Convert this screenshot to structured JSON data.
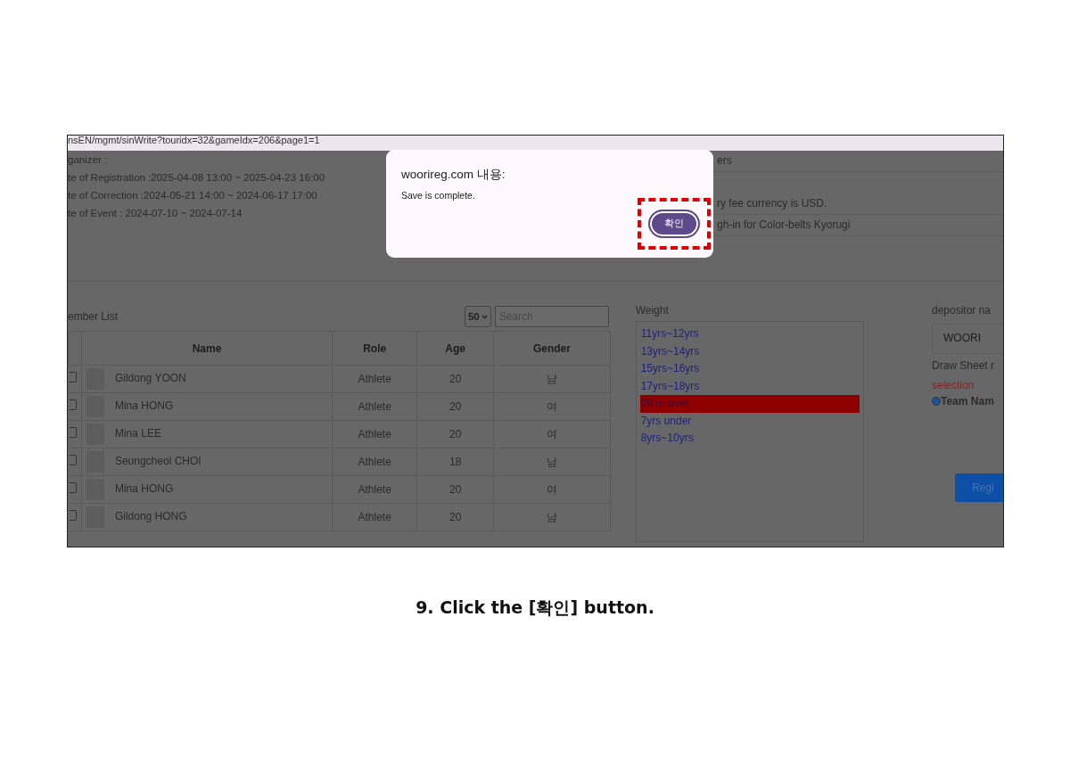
{
  "url_bar": {
    "text": "nsEN/mgmt/sinWrite?touridx=32&gameIdx=206&page1=1"
  },
  "event_info": [
    "ganizer :",
    "te of Registration :2025-04-08 13:00 ~ 2025-04-23 16:00",
    "te of Correction :2024-05-21 14:00 ~ 2024-06-17 17:00",
    "te of Event : 2024-07-10 ~ 2024-07-14"
  ],
  "notices": [
    "ers",
    "ry fee currency is USD.",
    "gh-in for Color-belts Kyorugi"
  ],
  "member_list": {
    "title": "ember List",
    "page_size": "50",
    "search_placeholder": "Search",
    "columns": [
      "Name",
      "Role",
      "Age",
      "Gender"
    ],
    "rows": [
      {
        "checked": false,
        "name": "Gildong YOON",
        "role": "Athlete",
        "age": "20",
        "gender": "남"
      },
      {
        "checked": false,
        "name": "Mina HONG",
        "role": "Athlete",
        "age": "20",
        "gender": "여"
      },
      {
        "checked": false,
        "name": "Mina LEE",
        "role": "Athlete",
        "age": "20",
        "gender": "여"
      },
      {
        "checked": false,
        "name": "Seungcheol CHOI",
        "role": "Athlete",
        "age": "18",
        "gender": "남"
      },
      {
        "checked": false,
        "name": "Mina HONG",
        "role": "Athlete",
        "age": "20",
        "gender": "여"
      },
      {
        "checked": false,
        "name": "Gildong HONG",
        "role": "Athlete",
        "age": "20",
        "gender": "남"
      }
    ]
  },
  "weight": {
    "label": "Weight",
    "items": [
      {
        "label": "11yrs~12yrs",
        "selected": false
      },
      {
        "label": "13yrs~14yrs",
        "selected": false
      },
      {
        "label": "15yrs~16yrs",
        "selected": false
      },
      {
        "label": "17yrs~18yrs",
        "selected": false
      },
      {
        "label": "19 or over",
        "selected": true
      },
      {
        "label": "7yrs under",
        "selected": false
      },
      {
        "label": "8yrs~10yrs",
        "selected": false
      }
    ]
  },
  "depositor": {
    "label": "depositor na",
    "value": "WOORI",
    "draw_sheet_label": "Draw Sheet r",
    "selection_label": "selection",
    "radio": {
      "label": "Team Nam",
      "selected": true
    },
    "register_button": "Regi"
  },
  "dialog": {
    "title": "woorireg.com 내용:",
    "message": "Save is complete.",
    "ok_button": "확인",
    "highlighted": true
  },
  "caption": "9. Click the [확인] button."
}
